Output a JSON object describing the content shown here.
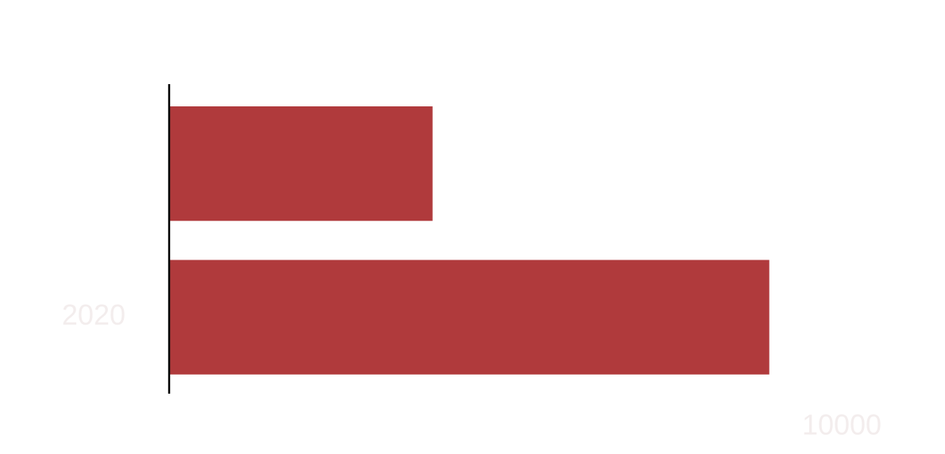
{
  "chart_data": {
    "type": "bar",
    "orientation": "horizontal",
    "categories": [
      "",
      "2020"
    ],
    "values": [
      3900,
      8900
    ],
    "xlim": [
      0,
      10000
    ],
    "x_ticks": [
      "10000"
    ],
    "title": "",
    "xlabel": "",
    "ylabel": "",
    "grid": false,
    "bar_color": "#b03a3c",
    "label_color": "#f3eded",
    "axis_color": "#000000"
  }
}
